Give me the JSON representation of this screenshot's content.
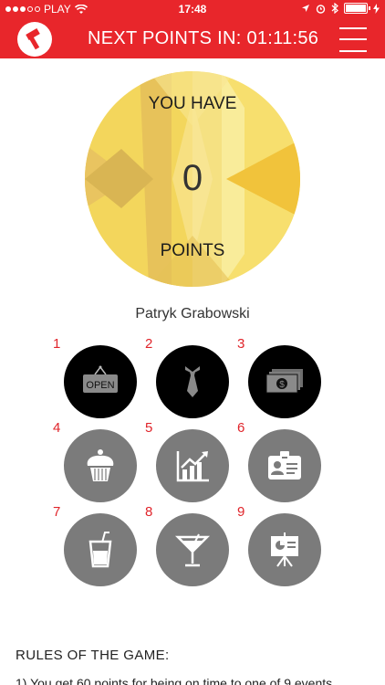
{
  "status_bar": {
    "carrier": "PLAY",
    "time": "17:48"
  },
  "header": {
    "title": "NEXT POINTS IN: 01:11:56"
  },
  "points": {
    "line1": "YOU HAVE",
    "value": "0",
    "line2": "POINTS"
  },
  "user": {
    "name": "Patryk Grabowski"
  },
  "events": [
    {
      "number": "1",
      "icon": "open-sign-icon",
      "active": true,
      "sign_text": "OPEN"
    },
    {
      "number": "2",
      "icon": "tie-icon",
      "active": true
    },
    {
      "number": "3",
      "icon": "money-icon",
      "active": true
    },
    {
      "number": "4",
      "icon": "cupcake-icon",
      "active": false
    },
    {
      "number": "5",
      "icon": "chart-icon",
      "active": false
    },
    {
      "number": "6",
      "icon": "id-badge-icon",
      "active": false
    },
    {
      "number": "7",
      "icon": "drink-cup-icon",
      "active": false
    },
    {
      "number": "8",
      "icon": "cocktail-icon",
      "active": false
    },
    {
      "number": "9",
      "icon": "presentation-icon",
      "active": false
    }
  ],
  "rules": {
    "title": "RULES OF THE GAME:",
    "line1": "1) You get 60 points for being on time to one of 9 events"
  },
  "colors": {
    "brand_red": "#e8262b",
    "active_event": "#000000",
    "inactive_event": "#7b7b7b",
    "disc_yellow": "#f3d55a"
  }
}
